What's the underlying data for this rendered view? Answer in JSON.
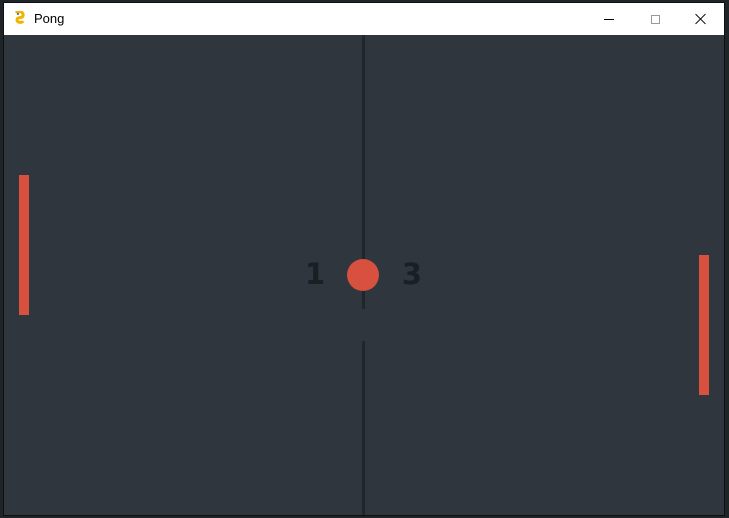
{
  "window": {
    "title": "Pong"
  },
  "colors": {
    "board": "#2f363e",
    "net": "#1f252b",
    "paddle": "#d8503e",
    "ball": "#d8503e",
    "score": "#1a1f24",
    "titlebar": "#ffffff"
  },
  "scores": {
    "left": "1",
    "right": "3"
  },
  "icons": {
    "app": "pygame-snake-icon",
    "minimize": "minimize-icon",
    "maximize": "maximize-icon",
    "close": "close-icon"
  }
}
